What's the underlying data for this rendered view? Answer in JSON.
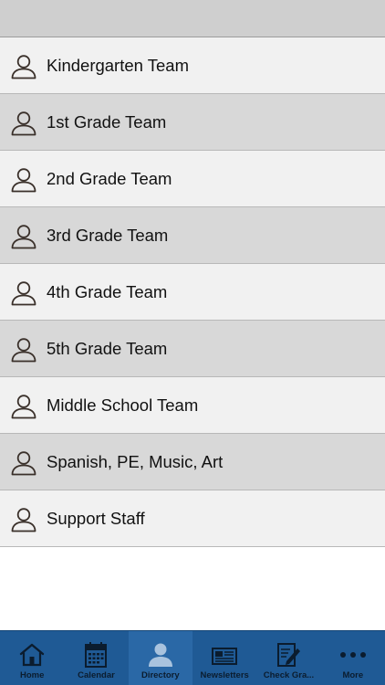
{
  "directory": {
    "items": [
      {
        "label": "Kindergarten Team"
      },
      {
        "label": "1st Grade Team"
      },
      {
        "label": "2nd Grade Team"
      },
      {
        "label": "3rd Grade Team"
      },
      {
        "label": "4th Grade Team"
      },
      {
        "label": "5th Grade Team"
      },
      {
        "label": "Middle School Team"
      },
      {
        "label": "Spanish, PE, Music, Art"
      },
      {
        "label": "Support Staff"
      }
    ]
  },
  "tabbar": {
    "active_tab": "Directory",
    "tabs": [
      {
        "label": "Home",
        "icon": "home-icon"
      },
      {
        "label": "Calendar",
        "icon": "calendar-icon"
      },
      {
        "label": "Directory",
        "icon": "person-icon"
      },
      {
        "label": "Newsletters",
        "icon": "newspaper-icon"
      },
      {
        "label": "Check Gra...",
        "icon": "edit-document-icon"
      },
      {
        "label": "More",
        "icon": "more-dots-icon"
      }
    ]
  },
  "colors": {
    "tabbar_bg": "#1f5a95",
    "row_light": "#f1f1f1",
    "row_dark": "#d8d8d8",
    "topbar_bg": "#cfcfcf"
  }
}
